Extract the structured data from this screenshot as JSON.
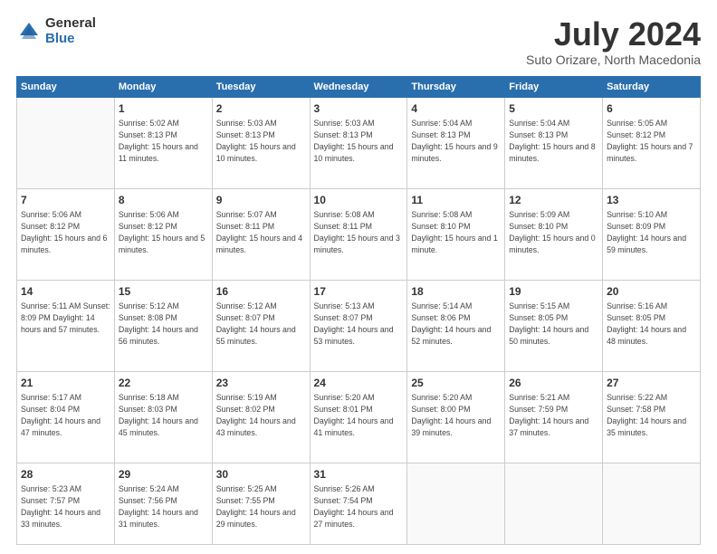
{
  "logo": {
    "general": "General",
    "blue": "Blue"
  },
  "title": "July 2024",
  "subtitle": "Suto Orizare, North Macedonia",
  "days_of_week": [
    "Sunday",
    "Monday",
    "Tuesday",
    "Wednesday",
    "Thursday",
    "Friday",
    "Saturday"
  ],
  "weeks": [
    [
      {
        "day": "",
        "info": ""
      },
      {
        "day": "1",
        "info": "Sunrise: 5:02 AM\nSunset: 8:13 PM\nDaylight: 15 hours\nand 11 minutes."
      },
      {
        "day": "2",
        "info": "Sunrise: 5:03 AM\nSunset: 8:13 PM\nDaylight: 15 hours\nand 10 minutes."
      },
      {
        "day": "3",
        "info": "Sunrise: 5:03 AM\nSunset: 8:13 PM\nDaylight: 15 hours\nand 10 minutes."
      },
      {
        "day": "4",
        "info": "Sunrise: 5:04 AM\nSunset: 8:13 PM\nDaylight: 15 hours\nand 9 minutes."
      },
      {
        "day": "5",
        "info": "Sunrise: 5:04 AM\nSunset: 8:13 PM\nDaylight: 15 hours\nand 8 minutes."
      },
      {
        "day": "6",
        "info": "Sunrise: 5:05 AM\nSunset: 8:12 PM\nDaylight: 15 hours\nand 7 minutes."
      }
    ],
    [
      {
        "day": "7",
        "info": "Sunrise: 5:06 AM\nSunset: 8:12 PM\nDaylight: 15 hours\nand 6 minutes."
      },
      {
        "day": "8",
        "info": "Sunrise: 5:06 AM\nSunset: 8:12 PM\nDaylight: 15 hours\nand 5 minutes."
      },
      {
        "day": "9",
        "info": "Sunrise: 5:07 AM\nSunset: 8:11 PM\nDaylight: 15 hours\nand 4 minutes."
      },
      {
        "day": "10",
        "info": "Sunrise: 5:08 AM\nSunset: 8:11 PM\nDaylight: 15 hours\nand 3 minutes."
      },
      {
        "day": "11",
        "info": "Sunrise: 5:08 AM\nSunset: 8:10 PM\nDaylight: 15 hours\nand 1 minute."
      },
      {
        "day": "12",
        "info": "Sunrise: 5:09 AM\nSunset: 8:10 PM\nDaylight: 15 hours\nand 0 minutes."
      },
      {
        "day": "13",
        "info": "Sunrise: 5:10 AM\nSunset: 8:09 PM\nDaylight: 14 hours\nand 59 minutes."
      }
    ],
    [
      {
        "day": "14",
        "info": "Sunrise: 5:11 AM\nSunset: 8:09 PM\nDaylight: 14 hours\nand 57 minutes."
      },
      {
        "day": "15",
        "info": "Sunrise: 5:12 AM\nSunset: 8:08 PM\nDaylight: 14 hours\nand 56 minutes."
      },
      {
        "day": "16",
        "info": "Sunrise: 5:12 AM\nSunset: 8:07 PM\nDaylight: 14 hours\nand 55 minutes."
      },
      {
        "day": "17",
        "info": "Sunrise: 5:13 AM\nSunset: 8:07 PM\nDaylight: 14 hours\nand 53 minutes."
      },
      {
        "day": "18",
        "info": "Sunrise: 5:14 AM\nSunset: 8:06 PM\nDaylight: 14 hours\nand 52 minutes."
      },
      {
        "day": "19",
        "info": "Sunrise: 5:15 AM\nSunset: 8:05 PM\nDaylight: 14 hours\nand 50 minutes."
      },
      {
        "day": "20",
        "info": "Sunrise: 5:16 AM\nSunset: 8:05 PM\nDaylight: 14 hours\nand 48 minutes."
      }
    ],
    [
      {
        "day": "21",
        "info": "Sunrise: 5:17 AM\nSunset: 8:04 PM\nDaylight: 14 hours\nand 47 minutes."
      },
      {
        "day": "22",
        "info": "Sunrise: 5:18 AM\nSunset: 8:03 PM\nDaylight: 14 hours\nand 45 minutes."
      },
      {
        "day": "23",
        "info": "Sunrise: 5:19 AM\nSunset: 8:02 PM\nDaylight: 14 hours\nand 43 minutes."
      },
      {
        "day": "24",
        "info": "Sunrise: 5:20 AM\nSunset: 8:01 PM\nDaylight: 14 hours\nand 41 minutes."
      },
      {
        "day": "25",
        "info": "Sunrise: 5:20 AM\nSunset: 8:00 PM\nDaylight: 14 hours\nand 39 minutes."
      },
      {
        "day": "26",
        "info": "Sunrise: 5:21 AM\nSunset: 7:59 PM\nDaylight: 14 hours\nand 37 minutes."
      },
      {
        "day": "27",
        "info": "Sunrise: 5:22 AM\nSunset: 7:58 PM\nDaylight: 14 hours\nand 35 minutes."
      }
    ],
    [
      {
        "day": "28",
        "info": "Sunrise: 5:23 AM\nSunset: 7:57 PM\nDaylight: 14 hours\nand 33 minutes."
      },
      {
        "day": "29",
        "info": "Sunrise: 5:24 AM\nSunset: 7:56 PM\nDaylight: 14 hours\nand 31 minutes."
      },
      {
        "day": "30",
        "info": "Sunrise: 5:25 AM\nSunset: 7:55 PM\nDaylight: 14 hours\nand 29 minutes."
      },
      {
        "day": "31",
        "info": "Sunrise: 5:26 AM\nSunset: 7:54 PM\nDaylight: 14 hours\nand 27 minutes."
      },
      {
        "day": "",
        "info": ""
      },
      {
        "day": "",
        "info": ""
      },
      {
        "day": "",
        "info": ""
      }
    ]
  ]
}
